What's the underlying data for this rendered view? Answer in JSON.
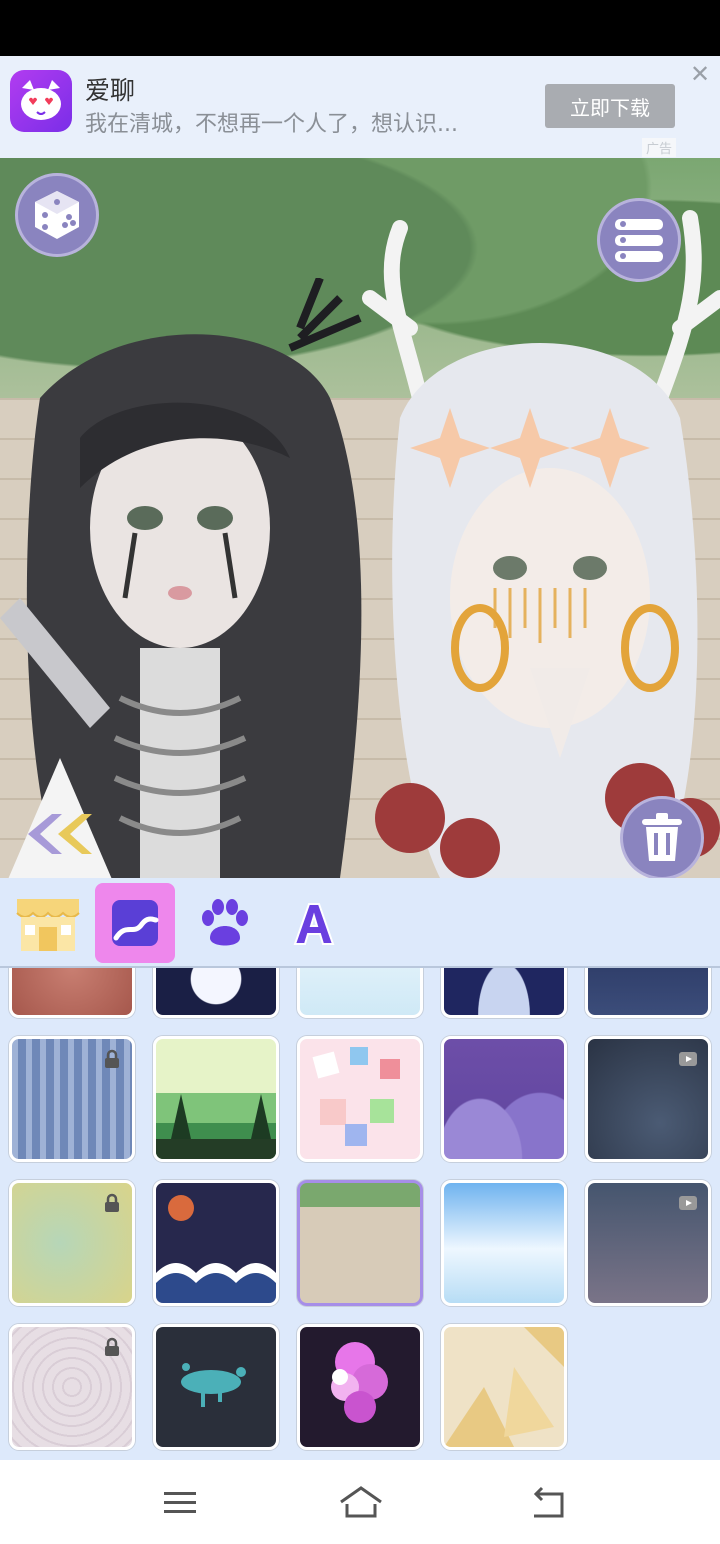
{
  "ad": {
    "app_name": "爱聊",
    "description": "我在清城，不想再一个人了，想认识...",
    "download_label": "立即下载",
    "close_symbol": "✕",
    "ad_tag": "广告",
    "logo_icon": "cat-heart-eyes-icon"
  },
  "scene": {
    "buttons": {
      "random": "dice-icon",
      "list": "list-icon",
      "delete": "trash-icon",
      "collapse": "double-chevron-left-icon"
    }
  },
  "tabs": [
    {
      "name": "shop",
      "icon": "shop-icon",
      "selected": false
    },
    {
      "name": "background",
      "icon": "picture-icon",
      "selected": true
    },
    {
      "name": "pet",
      "icon": "paw-icon",
      "selected": false
    },
    {
      "name": "text",
      "icon": "letter-a-icon",
      "selected": false
    }
  ],
  "backgrounds": [
    {
      "theme": "red planet",
      "locked": false
    },
    {
      "theme": "night moon",
      "locked": false
    },
    {
      "theme": "lily pond",
      "locked": false
    },
    {
      "theme": "starry sky",
      "locked": false
    },
    {
      "theme": "galaxy",
      "locked": false
    },
    {
      "theme": "blue bamboo",
      "locked": true
    },
    {
      "theme": "green hills",
      "locked": false
    },
    {
      "theme": "pink pattern",
      "locked": false
    },
    {
      "theme": "purple clouds",
      "locked": false
    },
    {
      "theme": "spider web",
      "locked": false,
      "video": true
    },
    {
      "theme": "golden waves",
      "locked": true
    },
    {
      "theme": "sea waves night",
      "locked": false
    },
    {
      "theme": "garden wall",
      "locked": false,
      "selected": true
    },
    {
      "theme": "sky clouds",
      "locked": false
    },
    {
      "theme": "moon dusk",
      "locked": false,
      "video": true
    },
    {
      "theme": "pink lace",
      "locked": true
    },
    {
      "theme": "teal splash",
      "locked": false
    },
    {
      "theme": "pink bubbles",
      "locked": false
    },
    {
      "theme": "paper fans",
      "locked": false
    }
  ],
  "nav": {
    "menu": "menu-icon",
    "home": "home-icon",
    "back": "back-icon"
  },
  "colors": {
    "accent": "#8a84bf",
    "tab_selected": "#ee87ec",
    "panel_bg": "#dde9fb"
  }
}
